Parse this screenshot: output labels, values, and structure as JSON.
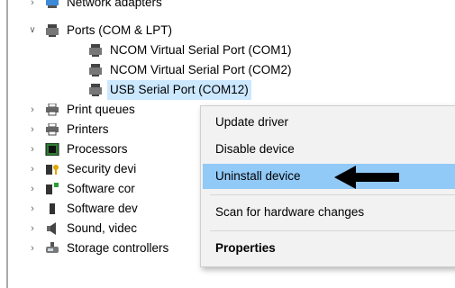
{
  "tree": {
    "network_adapters": "Network adapters",
    "ports": "Ports (COM & LPT)",
    "ports_children": [
      "NCOM Virtual Serial Port (COM1)",
      "NCOM Virtual Serial Port (COM2)",
      "USB Serial Port (COM12)"
    ],
    "print_queues": "Print queues",
    "printers": "Printers",
    "processors": "Processors",
    "security_devices": "Security devi",
    "software_components": "Software cor",
    "software_devices": "Software dev",
    "sound": "Sound, videc",
    "storage": "Storage controllers"
  },
  "context_menu": {
    "update_driver": "Update driver",
    "disable_device": "Disable device",
    "uninstall_device": "Uninstall device",
    "scan_hardware": "Scan for hardware changes",
    "properties": "Properties"
  },
  "colors": {
    "selection": "#cce8ff",
    "menu_highlight": "#91c9f7",
    "menu_bg": "#f2f2f2"
  }
}
